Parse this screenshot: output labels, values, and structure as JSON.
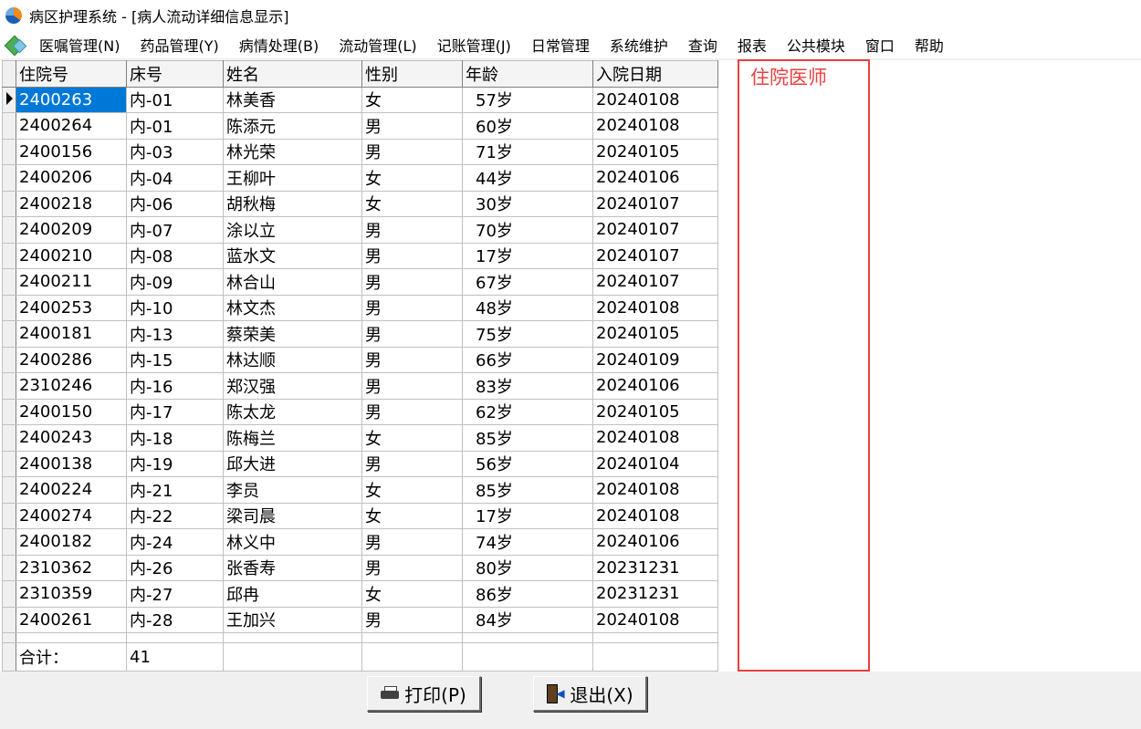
{
  "window": {
    "title": "病区护理系统 - [病人流动详细信息显示]"
  },
  "menu": [
    "医嘱管理(N)",
    "药品管理(Y)",
    "病情处理(B)",
    "流动管理(L)",
    "记账管理(J)",
    "日常管理",
    "系统维护",
    "查询",
    "报表",
    "公共模块",
    "窗口",
    "帮助"
  ],
  "grid": {
    "headers": [
      "住院号",
      "床号",
      "姓名",
      "性别",
      "年龄",
      "入院日期"
    ],
    "rows": [
      [
        "2400263",
        "内-01",
        "林美香",
        "女",
        "57岁",
        "20240108"
      ],
      [
        "2400264",
        "内-01",
        "陈添元",
        "男",
        "60岁",
        "20240108"
      ],
      [
        "2400156",
        "内-03",
        "林光荣",
        "男",
        "71岁",
        "20240105"
      ],
      [
        "2400206",
        "内-04",
        "王柳叶",
        "女",
        "44岁",
        "20240106"
      ],
      [
        "2400218",
        "内-06",
        "胡秋梅",
        "女",
        "30岁",
        "20240107"
      ],
      [
        "2400209",
        "内-07",
        "涂以立",
        "男",
        "70岁",
        "20240107"
      ],
      [
        "2400210",
        "内-08",
        "蓝水文",
        "男",
        "17岁",
        "20240107"
      ],
      [
        "2400211",
        "内-09",
        "林合山",
        "男",
        "67岁",
        "20240107"
      ],
      [
        "2400253",
        "内-10",
        "林文杰",
        "男",
        "48岁",
        "20240108"
      ],
      [
        "2400181",
        "内-13",
        "蔡荣美",
        "男",
        "75岁",
        "20240105"
      ],
      [
        "2400286",
        "内-15",
        "林达顺",
        "男",
        "66岁",
        "20240109"
      ],
      [
        "2310246",
        "内-16",
        "郑汉强",
        "男",
        "83岁",
        "20240106"
      ],
      [
        "2400150",
        "内-17",
        "陈太龙",
        "男",
        "62岁",
        "20240105"
      ],
      [
        "2400243",
        "内-18",
        "陈梅兰",
        "女",
        "85岁",
        "20240108"
      ],
      [
        "2400138",
        "内-19",
        "邱大进",
        "男",
        "56岁",
        "20240104"
      ],
      [
        "2400224",
        "内-21",
        "李员",
        "女",
        "85岁",
        "20240108"
      ],
      [
        "2400274",
        "内-22",
        "梁司晨",
        "女",
        "17岁",
        "20240108"
      ],
      [
        "2400182",
        "内-24",
        "林义中",
        "男",
        "74岁",
        "20240106"
      ],
      [
        "2310362",
        "内-26",
        "张香寿",
        "男",
        "80岁",
        "20231231"
      ],
      [
        "2310359",
        "内-27",
        "邱冉",
        "女",
        "86岁",
        "20231231"
      ],
      [
        "2400261",
        "内-28",
        "王加兴",
        "男",
        "84岁",
        "20240108"
      ]
    ],
    "total_label": "合计：",
    "total_value": "41"
  },
  "doctor_column": {
    "label": "住院医师"
  },
  "buttons": {
    "print": "打印(P)",
    "exit": "退出(X)"
  },
  "colors": {
    "selection": "#0078d7",
    "highlight_box": "#e84040"
  }
}
